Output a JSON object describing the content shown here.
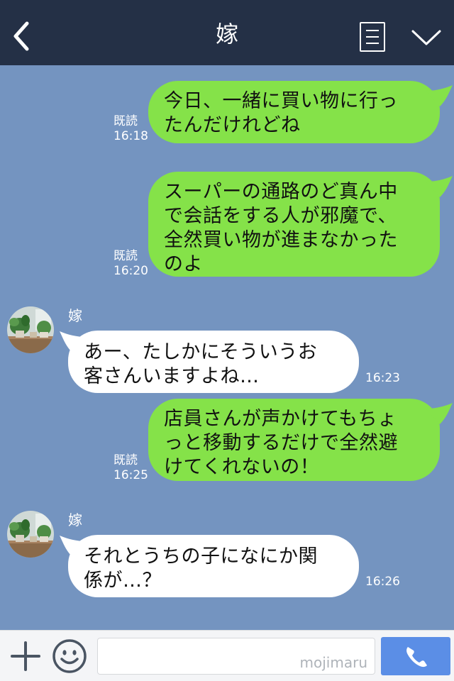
{
  "header": {
    "title": "嫁"
  },
  "messages": [
    {
      "direction": "outgoing",
      "lines": [
        "今日、一緒に買い物に行っ",
        "たんだけれどね"
      ],
      "read_label": "既読",
      "time": "16:18"
    },
    {
      "direction": "outgoing",
      "lines": [
        "スーパーの通路のど真ん中",
        "で会話をする人が邪魔で、",
        "全然買い物が進まなかった",
        "のよ"
      ],
      "read_label": "既読",
      "time": "16:20"
    },
    {
      "direction": "incoming",
      "sender": "嫁",
      "lines": [
        "あー、たしかにそういうお",
        "客さんいますよね…"
      ],
      "time": "16:23"
    },
    {
      "direction": "outgoing",
      "lines": [
        "店員さんが声かけてもちょ",
        "っと移動するだけで全然避",
        "けてくれないの！"
      ],
      "read_label": "既読",
      "time": "16:25"
    },
    {
      "direction": "incoming",
      "sender": "嫁",
      "lines": [
        "それとうちの子になにか関",
        "係が…？"
      ],
      "time": "16:26"
    }
  ],
  "footer": {
    "watermark": "mojimaru",
    "input_value": ""
  },
  "icons": {
    "back": "chevron-left-icon",
    "menu": "menu-icon",
    "collapse": "chevron-down-icon",
    "add": "plus-icon",
    "emoji": "smiley-icon",
    "call": "phone-icon"
  },
  "colors": {
    "header_bg": "#243046",
    "chat_bg": "#7494c0",
    "outgoing_bubble": "#85e249",
    "incoming_bubble": "#ffffff",
    "call_button": "#5b8ee6"
  }
}
